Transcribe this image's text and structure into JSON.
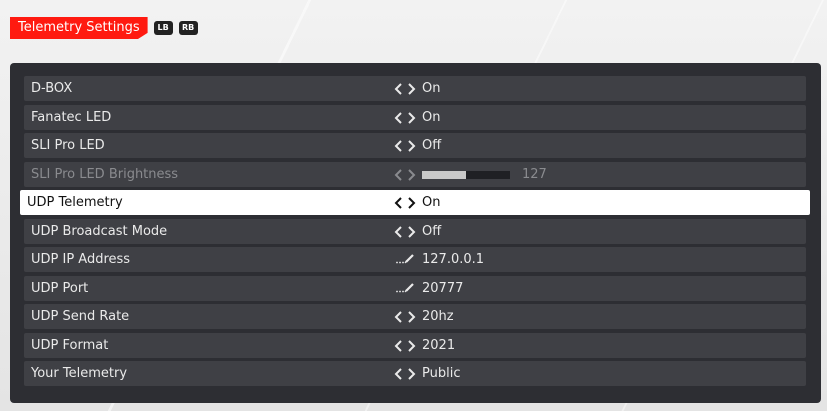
{
  "header": {
    "title": "Telemetry Settings",
    "left_bumper": "LB",
    "right_bumper": "RB"
  },
  "colors": {
    "accent": "#ff1a10",
    "panel": "#2d2e33",
    "row": "#3f4045",
    "selected": "#ffffff"
  },
  "settings": [
    {
      "label": "D-BOX",
      "value": "On",
      "control": "arrows"
    },
    {
      "label": "Fanatec LED",
      "value": "On",
      "control": "arrows"
    },
    {
      "label": "SLI Pro LED",
      "value": "Off",
      "control": "arrows"
    },
    {
      "label": "SLI Pro LED Brightness",
      "value": "127",
      "control": "slider",
      "fill_fraction": 0.5,
      "disabled": true
    },
    {
      "label": "UDP Telemetry",
      "value": "On",
      "control": "arrows",
      "selected": true
    },
    {
      "label": "UDP Broadcast Mode",
      "value": "Off",
      "control": "arrows"
    },
    {
      "label": "UDP IP Address",
      "value": "127.0.0.1",
      "control": "edit"
    },
    {
      "label": "UDP Port",
      "value": "20777",
      "control": "edit"
    },
    {
      "label": "UDP Send Rate",
      "value": "20hz",
      "control": "arrows"
    },
    {
      "label": "UDP Format",
      "value": "2021",
      "control": "arrows"
    },
    {
      "label": "Your Telemetry",
      "value": "Public",
      "control": "arrows"
    }
  ]
}
